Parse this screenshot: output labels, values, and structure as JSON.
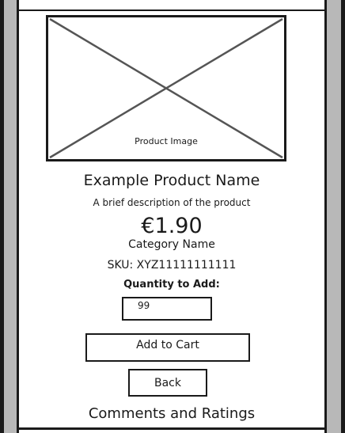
{
  "product": {
    "image_caption": "Product Image",
    "name": "Example Product Name",
    "description": "A brief description of the product",
    "price": "€1.90",
    "category": "Category Name",
    "sku": "SKU:  XYZ11111111111"
  },
  "quantity": {
    "label": "Quantity to Add:",
    "value": "99"
  },
  "actions": {
    "add_to_cart_label": "Add to Cart",
    "back_label": "Back"
  },
  "comments": {
    "heading": "Comments and Ratings"
  }
}
